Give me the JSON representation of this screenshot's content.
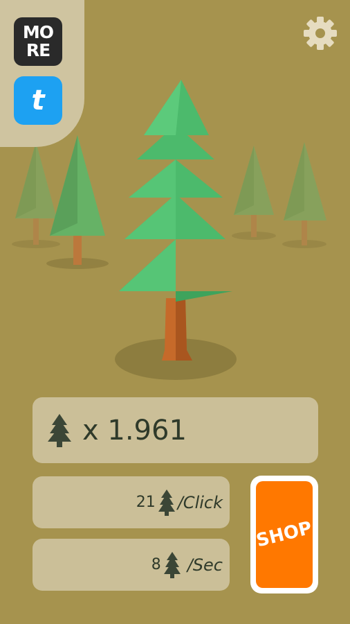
{
  "header": {
    "more_button": {
      "line1": "MO",
      "line2": "RE"
    },
    "tumblr_button": {
      "label": "t",
      "color": "#1da1f2"
    },
    "settings_icon": "gear-icon"
  },
  "stats": {
    "total_trees": "x 1.961",
    "per_click_value": "21",
    "per_click_unit": "/Click",
    "per_sec_value": "8",
    "per_sec_unit": "/Sec"
  },
  "shop": {
    "label": "SHOP",
    "color": "#ff7800"
  },
  "colors": {
    "background": "#a6934e",
    "card": "#cbbf98",
    "tree_green": "#4dbd6f",
    "trunk": "#c66a2a"
  },
  "icons": {
    "tree": "pine-tree-icon"
  }
}
